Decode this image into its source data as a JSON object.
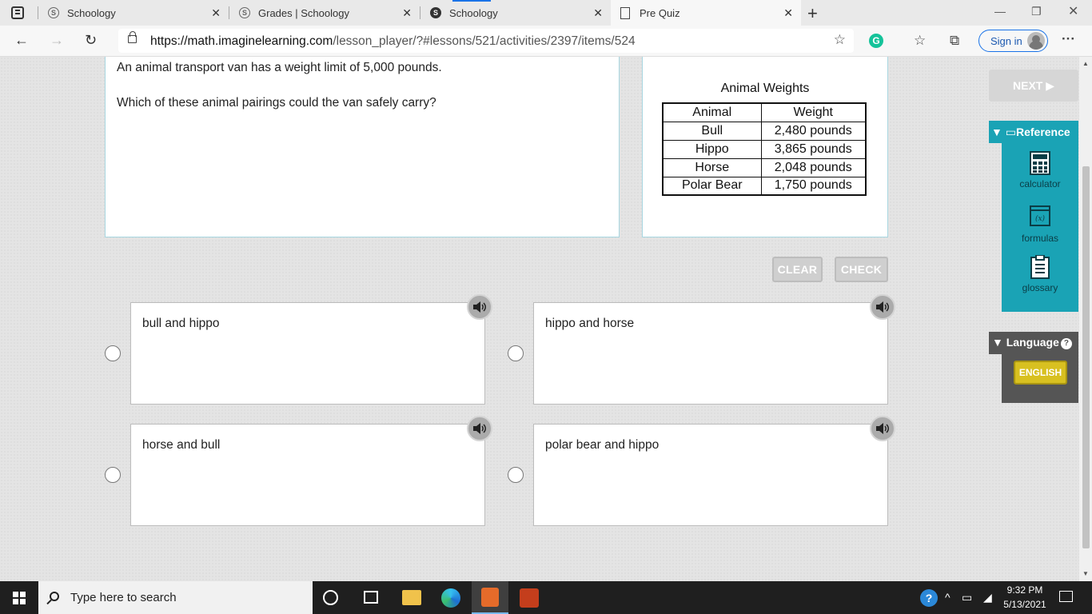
{
  "browser": {
    "tabs": [
      {
        "title": "Schoology",
        "close": "✕"
      },
      {
        "title": "Grades | Schoology",
        "close": "✕"
      },
      {
        "title": "Schoology",
        "close": "✕"
      },
      {
        "title": "Pre Quiz",
        "close": "✕"
      }
    ],
    "new_tab": "+",
    "url_domain": "https://math.imaginelearning.com",
    "url_path": "/lesson_player/?#lessons/521/activities/2397/items/524",
    "sign_in": "Sign in",
    "more": "···"
  },
  "question": {
    "line1": "An animal transport van has a weight limit of 5,000 pounds.",
    "line2": "Which of these animal pairings could the van safely carry?"
  },
  "table": {
    "title": "Animal Weights",
    "headers": [
      "Animal",
      "Weight"
    ],
    "rows": [
      [
        "Bull",
        "2,480 pounds"
      ],
      [
        "Hippo",
        "3,865 pounds"
      ],
      [
        "Horse",
        "2,048 pounds"
      ],
      [
        "Polar Bear",
        "1,750 pounds"
      ]
    ]
  },
  "actions": {
    "clear": "CLEAR",
    "check": "CHECK"
  },
  "choices": [
    "bull and hippo",
    "hippo and horse",
    "horse and bull",
    "polar bear and hippo"
  ],
  "sidebar": {
    "next": "NEXT ▶",
    "reference_title": "▼ ▭Reference",
    "tools": [
      {
        "label": "calculator",
        "icon": "calculator-icon"
      },
      {
        "label": "formulas",
        "icon": "formulas-icon"
      },
      {
        "label": "glossary",
        "icon": "glossary-icon"
      }
    ],
    "language_title": "▼ Language",
    "language_button": "ENGLISH",
    "accent_color": "#1aa3b5"
  },
  "taskbar": {
    "search_placeholder": "Type here to search",
    "time": "9:32 PM",
    "date": "5/13/2021"
  }
}
